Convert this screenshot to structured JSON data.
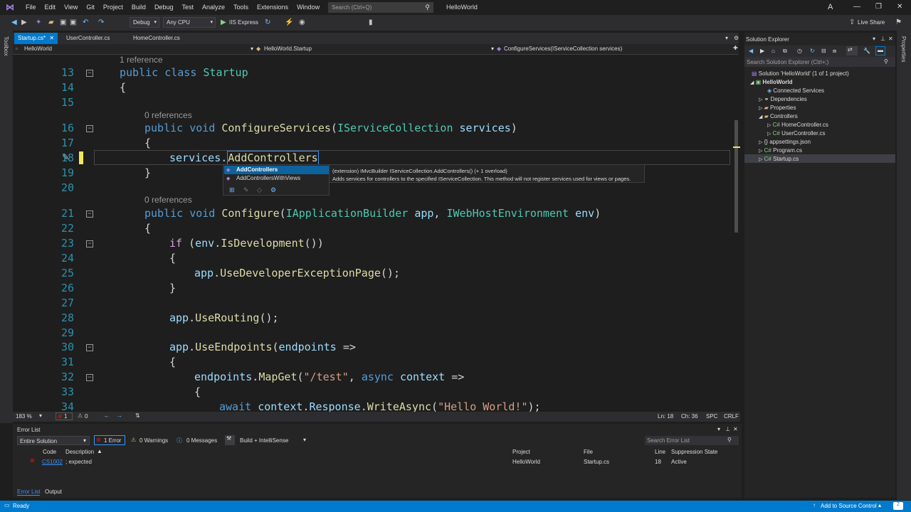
{
  "menu": [
    "File",
    "Edit",
    "View",
    "Git",
    "Project",
    "Build",
    "Debug",
    "Test",
    "Analyze",
    "Tools",
    "Extensions",
    "Window",
    "Help"
  ],
  "search": {
    "placeholder": "Search (Ctrl+Q)"
  },
  "solution_name": "HelloWorld",
  "avatar": "A",
  "toolbar": {
    "config": "Debug",
    "platform": "Any CPU",
    "run": "IIS Express",
    "live_share": "Live Share"
  },
  "toolbox_label": "Toolbox",
  "properties_label": "Properties",
  "tabs": [
    {
      "label": "Startup.cs*",
      "active": true
    },
    {
      "label": "UserController.cs"
    },
    {
      "label": "HomeController.cs"
    }
  ],
  "navbar": {
    "project": "HelloWorld",
    "class": "HelloWorld.Startup",
    "member": "ConfigureServices(IServiceCollection services)"
  },
  "code": {
    "lens1": "1 reference",
    "lens2": "0 references",
    "lens3": "0 references",
    "lines": [
      "13",
      "14",
      "15",
      "16",
      "17",
      "18",
      "19",
      "20",
      "21",
      "22",
      "23",
      "24",
      "25",
      "26",
      "27",
      "28",
      "29",
      "30",
      "31",
      "32",
      "33",
      "34"
    ]
  },
  "completion": {
    "items": [
      "AddControllers",
      "AddControllersWithViews"
    ],
    "sig": "(extension) IMvcBuilder IServiceCollection.AddControllers() (+ 1 overload)",
    "desc": "Adds services for controllers to the specified IServiceCollection. This method will not register services used for views or pages."
  },
  "editor_status": {
    "zoom": "183 %",
    "errors": "1",
    "warnings": "0",
    "ln": "Ln: 18",
    "ch": "Ch: 36",
    "spc": "SPC",
    "crlf": "CRLF"
  },
  "solution_explorer": {
    "title": "Solution Explorer",
    "search": "Search Solution Explorer (Ctrl+;)",
    "items": [
      "Solution 'HelloWorld' (1 of 1 project)",
      "HelloWorld",
      "Connected Services",
      "Dependencies",
      "Properties",
      "Controllers",
      "HomeController.cs",
      "UserController.cs",
      "appsettings.json",
      "Program.cs",
      "Startup.cs"
    ]
  },
  "error_list": {
    "title": "Error List",
    "scope": "Entire Solution",
    "errors_btn": "1 Error",
    "warnings_btn": "0 Warnings",
    "messages_btn": "0 Messages",
    "build_filter": "Build + IntelliSense",
    "search": "Search Error List",
    "headers": [
      "Code",
      "Description",
      "Project",
      "File",
      "Line",
      "Suppression State"
    ],
    "row": {
      "code": "CS1002",
      "description": "; expected",
      "project": "HelloWorld",
      "file": "Startup.cs",
      "line": "18",
      "state": "Active"
    },
    "bottom_tabs": [
      "Error List",
      "Output"
    ]
  },
  "status": {
    "ready": "Ready",
    "source_control": "Add to Source Control",
    "notif": "2"
  },
  "colors": {
    "accent": "#007acc",
    "error": "#e51400"
  }
}
